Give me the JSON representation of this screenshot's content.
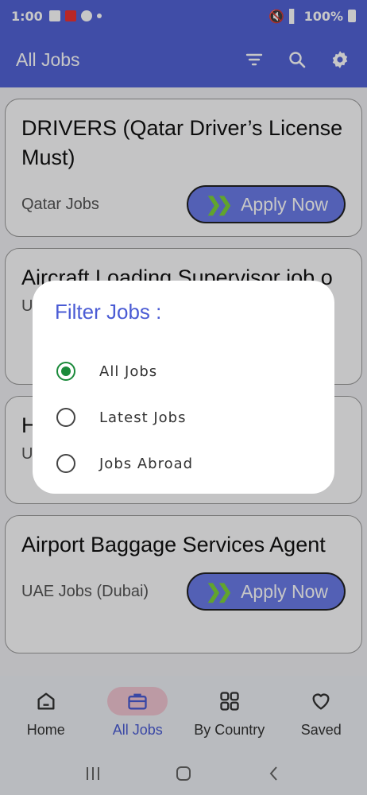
{
  "status_bar": {
    "time": "1:00",
    "battery": "100%"
  },
  "app_bar": {
    "title": "All Jobs",
    "icons": [
      "filter-icon",
      "search-icon",
      "settings-icon"
    ]
  },
  "jobs": [
    {
      "title": "DRIVERS (Qatar Driver’s License Must)",
      "location": "Qatar Jobs",
      "apply_label": "Apply Now"
    },
    {
      "title": "Aircraft Loading Supervisor job o",
      "location": "U",
      "apply_label": ""
    },
    {
      "title": "H",
      "location": "U",
      "apply_label": ""
    },
    {
      "title": "Airport Baggage Services Agent",
      "location": "UAE Jobs (Dubai)",
      "apply_label": "Apply Now"
    }
  ],
  "bottom_nav": [
    {
      "label": "Home",
      "icon": "home-icon"
    },
    {
      "label": "All Jobs",
      "icon": "briefcase-icon",
      "active": true
    },
    {
      "label": "By Country",
      "icon": "grid-icon"
    },
    {
      "label": "Saved",
      "icon": "heart-icon"
    }
  ],
  "filter_dialog": {
    "title": "Filter Jobs :",
    "options": [
      {
        "label": "All Jobs",
        "selected": true
      },
      {
        "label": "Latest Jobs",
        "selected": false
      },
      {
        "label": "Jobs Abroad",
        "selected": false
      }
    ]
  },
  "colors": {
    "primary": "#5263d6",
    "accent_button": "#6b7be8",
    "chevron": "#7dd33a",
    "radio_selected": "#1a8a3a"
  }
}
